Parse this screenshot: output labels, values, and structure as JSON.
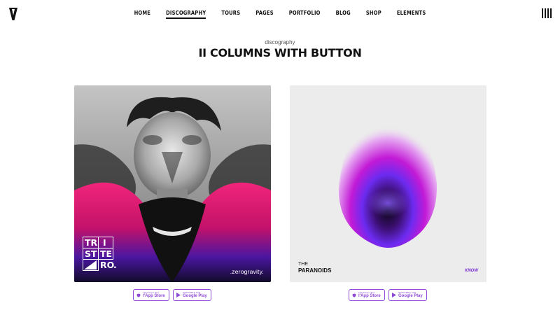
{
  "header": {
    "logo_icon": "v-logo-icon",
    "menu_icon": "hamburger-bars-icon",
    "nav": [
      {
        "label": "HOME",
        "active": false
      },
      {
        "label": "DISCOGRAPHY",
        "active": true
      },
      {
        "label": "TOURS",
        "active": false
      },
      {
        "label": "PAGES",
        "active": false
      },
      {
        "label": "PORTFOLIO",
        "active": false
      },
      {
        "label": "BLOG",
        "active": false
      },
      {
        "label": "SHOP",
        "active": false
      },
      {
        "label": "ELEMENTS",
        "active": false
      }
    ]
  },
  "page": {
    "kicker": "discography",
    "title": "II COLUMNS WITH BUTTON"
  },
  "albums": [
    {
      "cover_text": {
        "cells": [
          "TR",
          "I",
          "ST",
          "TE",
          "RO",
          "."
        ],
        "signature": ".zerogravity."
      },
      "badges": {
        "appstore_small": "Télécharger dans",
        "appstore_big": "l'App Store",
        "googleplay_small": "DISPONIBLE SUR",
        "googleplay_big": "Google Play"
      }
    },
    {
      "cover_text": {
        "the": "THE",
        "band": "PARANOIDS",
        "label": "KNOW"
      },
      "badges": {
        "appstore_small": "Télécharger dans",
        "appstore_big": "l'App Store",
        "googleplay_small": "DISPONIBLE SUR",
        "googleplay_big": "Google Play"
      }
    }
  ],
  "colors": {
    "accent": "#8e4bd6",
    "magenta": "#e01a6f",
    "violet": "#6a22c9"
  }
}
